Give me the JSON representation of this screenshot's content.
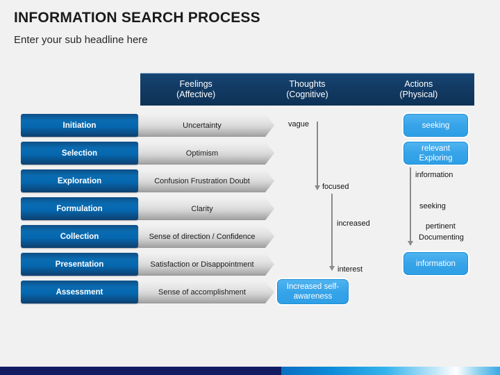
{
  "slide": {
    "title": "INFORMATION SEARCH PROCESS",
    "subtitle": "Enter your sub headline here"
  },
  "columns": [
    {
      "name": "Feelings",
      "qualifier": "(Affective)"
    },
    {
      "name": "Thoughts",
      "qualifier": "(Cognitive)"
    },
    {
      "name": "Actions",
      "qualifier": "(Physical)"
    }
  ],
  "process_rows": [
    {
      "stage": "Initiation",
      "feeling": "Uncertainty"
    },
    {
      "stage": "Selection",
      "feeling": "Optimism"
    },
    {
      "stage": "Exploration",
      "feeling": "Confusion Frustration Doubt"
    },
    {
      "stage": "Formulation",
      "feeling": "Clarity"
    },
    {
      "stage": "Collection",
      "feeling": "Sense of direction / Confidence"
    },
    {
      "stage": "Presentation",
      "feeling": "Satisfaction or Disappointment"
    },
    {
      "stage": "Assessment",
      "feeling": "Sense of accomplishment"
    }
  ],
  "thoughts_column": {
    "labels": [
      {
        "text": "vague"
      },
      {
        "text": "focused"
      },
      {
        "text": "increased"
      },
      {
        "text": "interest"
      }
    ],
    "callout": "Increased self-awareness"
  },
  "actions_column": {
    "boxes": [
      {
        "text": "seeking"
      },
      {
        "text": "relevant Exploring"
      },
      {
        "text": "information"
      }
    ],
    "labels": [
      {
        "text": "information"
      },
      {
        "text": "seeking"
      },
      {
        "text": "pertinent"
      },
      {
        "text": "Documenting"
      }
    ]
  },
  "colors": {
    "background": "#f1f1f1",
    "header_bar": "#123a63",
    "stage_blue": "#0a6bb0",
    "feeling_gray": "#d2d2d2",
    "callout_blue": "#35a3e8",
    "arrow_gray": "#8a8a8a",
    "strip_navy": "#131c63"
  }
}
